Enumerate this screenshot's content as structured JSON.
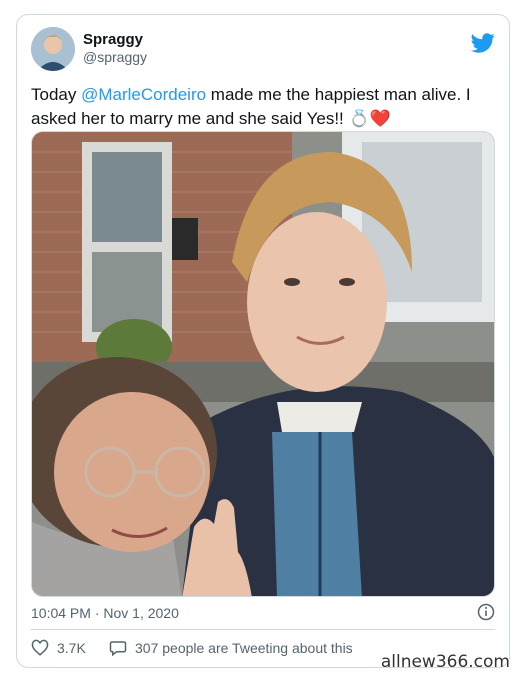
{
  "tweet": {
    "name": "Spraggy",
    "handle": "@spraggy",
    "text_before": "Today ",
    "mention": "@MarleCordeiro",
    "text_after": " made me the happiest man alive. I asked her to marry me and she said Yes!! 💍❤️",
    "timestamp": "10:04 PM · Nov 1, 2020",
    "likes": "3.7K",
    "conversation": "307 people are Tweeting about this"
  },
  "icons": {
    "platform": "twitter-bird-icon",
    "info": "info-icon",
    "like": "heart-icon",
    "reply": "speech-bubble-icon"
  },
  "colors": {
    "accent": "#1d9bf0",
    "heart": "#e0245e",
    "text": "#0f1419",
    "secondary": "#536471"
  },
  "watermark": "allnew366.com"
}
